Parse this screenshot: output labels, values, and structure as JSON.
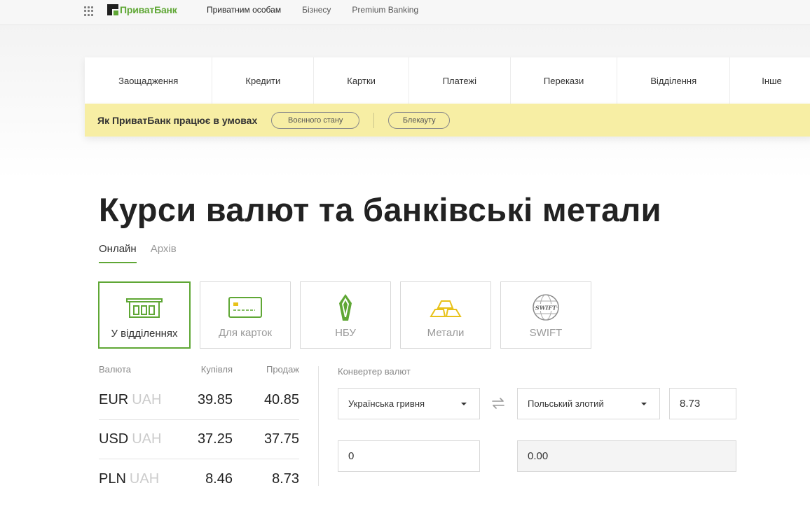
{
  "header": {
    "logo_text": "ПриватБанк",
    "nav": [
      "Приватним особам",
      "Бізнесу",
      "Premium Banking"
    ]
  },
  "categories": [
    "Заощадження",
    "Кредити",
    "Картки",
    "Платежі",
    "Перекази",
    "Відділення",
    "Інше"
  ],
  "banner": {
    "text": "Як ПриватБанк працює в умовах",
    "pill_1": "Воєнного стану",
    "pill_2": "Блекауту"
  },
  "page": {
    "title": "Курси валют та банківські метали",
    "tabs": [
      "Онлайн",
      "Архів"
    ]
  },
  "rate_types": [
    "У відділеннях",
    "Для карток",
    "НБУ",
    "Метали",
    "SWIFT"
  ],
  "rates": {
    "headers": [
      "Валюта",
      "Купівля",
      "Продаж"
    ],
    "rows": [
      {
        "currency": "EUR",
        "base": "UAH",
        "buy": "39.85",
        "sell": "40.85"
      },
      {
        "currency": "USD",
        "base": "UAH",
        "buy": "37.25",
        "sell": "37.75"
      },
      {
        "currency": "PLN",
        "base": "UAH",
        "buy": "8.46",
        "sell": "8.73"
      }
    ]
  },
  "converter": {
    "label": "Конвертер валют",
    "from_currency": "Українська гривня",
    "to_currency": "Польський злотий",
    "rate": "8.73",
    "input_value": "0",
    "output_value": "0.00"
  },
  "colors": {
    "brand_green": "#5fa735",
    "banner_yellow": "#f7eea4",
    "icon_gold": "#e8c21a"
  },
  "icons": [
    "apps-grid-icon",
    "privatbank-logo-icon",
    "branch-icon",
    "card-icon",
    "nbu-icon",
    "metals-icon",
    "swift-icon",
    "swap-icon",
    "chevron-down-icon"
  ]
}
